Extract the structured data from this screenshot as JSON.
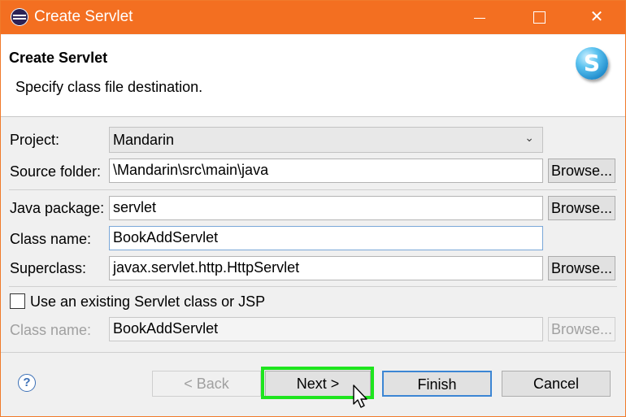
{
  "window": {
    "title": "Create Servlet",
    "controls": {
      "minimize": "—",
      "maximize": "☐",
      "close": "✕"
    },
    "accent_color": "#f36f21"
  },
  "header": {
    "title": "Create Servlet",
    "description": "Specify class file destination.",
    "badge_glyph": "S",
    "badge_icon": "servlet-wizard-icon"
  },
  "form": {
    "project": {
      "label": "Project:",
      "value": "Mandarin"
    },
    "source_folder": {
      "label": "Source folder:",
      "value": "\\Mandarin\\src\\main\\java",
      "button": "Browse..."
    },
    "java_package": {
      "label": "Java package:",
      "value": "servlet",
      "button": "Browse..."
    },
    "class_name": {
      "label": "Class name:",
      "value": "BookAddServlet"
    },
    "superclass": {
      "label": "Superclass:",
      "value": "javax.servlet.http.HttpServlet",
      "button": "Browse..."
    },
    "use_existing": {
      "label": "Use an existing Servlet class or JSP",
      "checked": false
    },
    "existing_class": {
      "label": "Class name:",
      "value": "BookAddServlet",
      "button": "Browse..."
    }
  },
  "footer": {
    "help_glyph": "?",
    "back": "< Back",
    "next": "Next >",
    "finish": "Finish",
    "cancel": "Cancel",
    "highlight_color": "#1ee51e"
  }
}
